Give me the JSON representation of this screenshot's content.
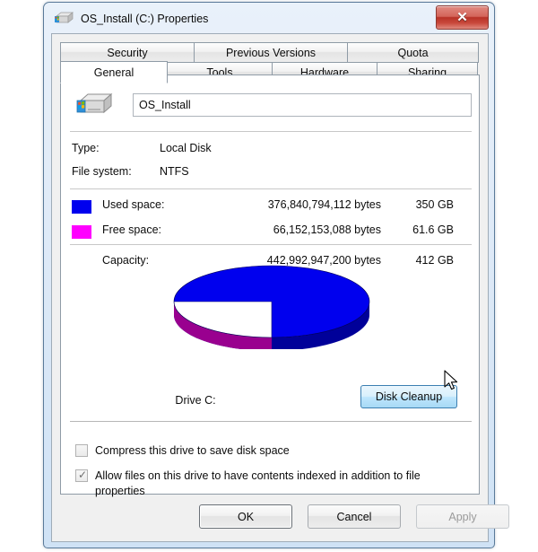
{
  "window": {
    "title": "OS_Install (C:) Properties",
    "icon": "hard-drive-icon",
    "close_label": "✕"
  },
  "tabs": {
    "top_row": [
      {
        "label": "Security",
        "active": false
      },
      {
        "label": "Previous Versions",
        "active": false
      },
      {
        "label": "Quota",
        "active": false
      }
    ],
    "bottom_row": [
      {
        "label": "General",
        "active": true
      },
      {
        "label": "Tools",
        "active": false
      },
      {
        "label": "Hardware",
        "active": false
      },
      {
        "label": "Sharing",
        "active": false
      }
    ]
  },
  "general": {
    "volume_label_value": "OS_Install",
    "volume_label_placeholder": "",
    "type_label": "Type:",
    "type_value": "Local Disk",
    "filesystem_label": "File system:",
    "filesystem_value": "NTFS",
    "used": {
      "label": "Used space:",
      "bytes": "376,840,794,112 bytes",
      "size": "350 GB",
      "color": "#0000ee"
    },
    "free": {
      "label": "Free space:",
      "bytes": "66,152,153,088 bytes",
      "size": "61.6 GB",
      "color": "#ff00ff"
    },
    "capacity": {
      "label": "Capacity:",
      "bytes": "442,992,947,200 bytes",
      "size": "412 GB"
    },
    "drive_caption": "Drive C:",
    "disk_cleanup_label": "Disk Cleanup",
    "compress_checkbox": {
      "label": "Compress this drive to save disk space",
      "checked": false
    },
    "index_checkbox": {
      "label": "Allow files on this drive to have contents indexed in addition to file properties",
      "checked": true,
      "mark": "✓"
    }
  },
  "chart_data": {
    "type": "pie",
    "title": "Drive C:",
    "categories": [
      "Used space",
      "Free space"
    ],
    "values": [
      376840794112,
      66152153088
    ],
    "value_labels": [
      "350 GB",
      "61.6 GB"
    ],
    "percentages": [
      85.07,
      14.93
    ],
    "colors": [
      "#0000ee",
      "#ff00ff"
    ],
    "side_colors": [
      "#000099",
      "#99008f"
    ],
    "legend_position": "above",
    "style": "3d-pie"
  },
  "footer": {
    "ok_label": "OK",
    "cancel_label": "Cancel",
    "apply_label": "Apply",
    "apply_enabled": false
  }
}
